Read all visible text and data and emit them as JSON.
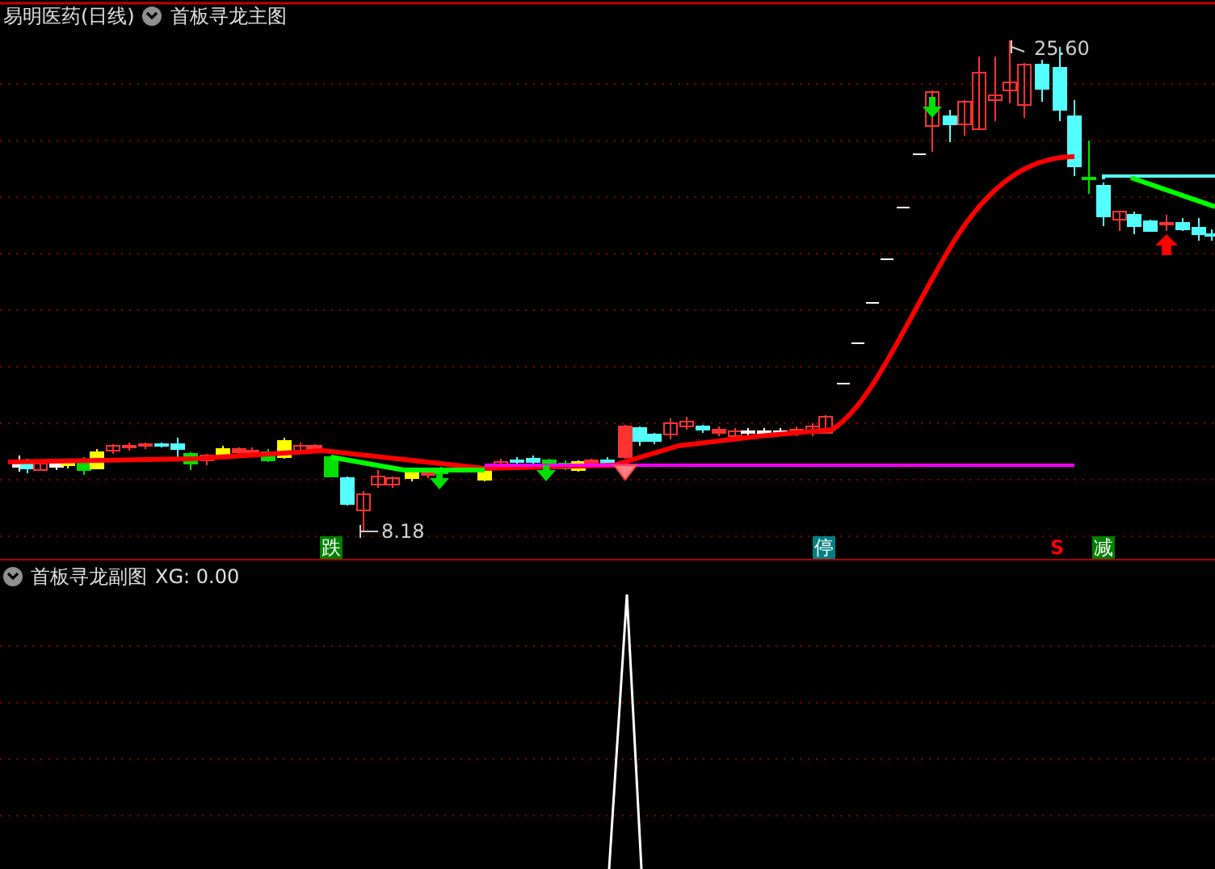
{
  "main_chart": {
    "stock": "易明医药(日线)",
    "indicator": "首板寻龙主图",
    "high_label": "25.60",
    "low_label": "8.18",
    "markers": [
      {
        "text": "跌",
        "kind": "box",
        "color": "#008000"
      },
      {
        "text": "停",
        "kind": "box",
        "color": "#008080"
      },
      {
        "text": "S",
        "kind": "plain",
        "color": "#ff0000"
      },
      {
        "text": "减",
        "kind": "box",
        "color": "#008000"
      }
    ]
  },
  "sub_chart": {
    "indicator": "首板寻龙副图",
    "reading": "XG: 0.00"
  }
}
